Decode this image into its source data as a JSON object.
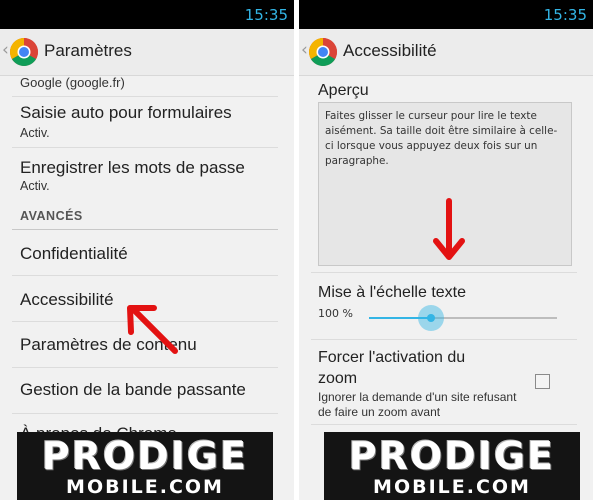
{
  "left_screen": {
    "status_time": "15:35",
    "title": "Paramètres",
    "items": [
      {
        "label": "Google (google.fr)"
      },
      {
        "label": "Saisie auto pour formulaires",
        "sub": "Activ."
      },
      {
        "label": "Enregistrer les mots de passe",
        "sub": "Activ."
      }
    ],
    "section_header": "AVANCÉS",
    "advanced_items": [
      {
        "label": "Confidentialité"
      },
      {
        "label": "Accessibilité"
      },
      {
        "label": "Paramètres de contenu"
      },
      {
        "label": "Gestion de la bande passante"
      },
      {
        "label": "À propos de Chrome"
      }
    ]
  },
  "right_screen": {
    "status_time": "15:35",
    "title": "Accessibilité",
    "preview_label": "Aperçu",
    "preview_text": "Faites glisser le curseur pour lire le texte aisément. Sa taille doit être similaire à celle-ci lorsque vous appuyez deux fois sur un paragraphe.",
    "text_scaling_label": "Mise à l'échelle texte",
    "text_scaling_value": "100 %",
    "text_scaling_slider_fraction": 0.33,
    "force_zoom_label": "Forcer l'activation du zoom",
    "force_zoom_desc": "Ignorer la demande d'un site refusant de faire un zoom avant",
    "force_zoom_checked": false
  },
  "watermark": {
    "line1": "PRODIGE",
    "line2": "MOBILE.COM"
  },
  "colors": {
    "accent": "#33b5e5",
    "arrow": "#e31212",
    "status_bar": "#000000"
  }
}
